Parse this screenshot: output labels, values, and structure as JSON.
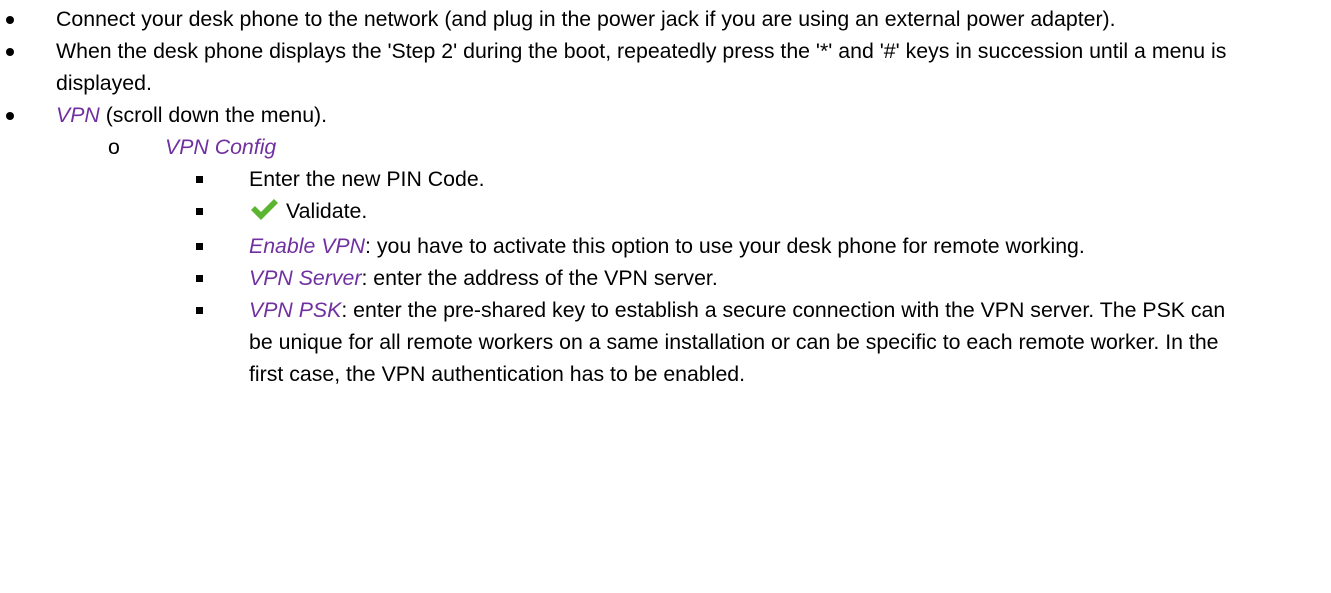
{
  "items": [
    {
      "text": "Connect your desk phone to the network (and plug in the power jack if you are using an external power adapter)."
    },
    {
      "text": "When the desk phone displays the 'Step 2' during the boot, repeatedly press the '*' and '#' keys in succession until a menu is displayed."
    },
    {
      "menu": "VPN",
      "text": " (scroll down the menu)."
    }
  ],
  "sub_item": {
    "marker": "o",
    "menu": "VPN Config"
  },
  "sub_sub_items": [
    {
      "text": "Enter the new PIN Code."
    },
    {
      "icon": "checkmark-icon",
      "icon_color": "#5cb531",
      "text": "Validate."
    },
    {
      "menu": "Enable VPN",
      "text": ": you have to activate this option to use your desk phone for remote working."
    },
    {
      "menu": "VPN Server",
      "text": ": enter the address of the VPN server."
    },
    {
      "menu": "VPN PSK",
      "text": ": enter the pre-shared key to establish a secure connection with the VPN server. The PSK can be unique for all remote workers on a same installation or can be specific to each remote worker. In the first case, the VPN authentication has to be enabled."
    }
  ],
  "colors": {
    "menu_text": "#7030a0",
    "body_text": "#000000",
    "check": "#5cb531"
  }
}
